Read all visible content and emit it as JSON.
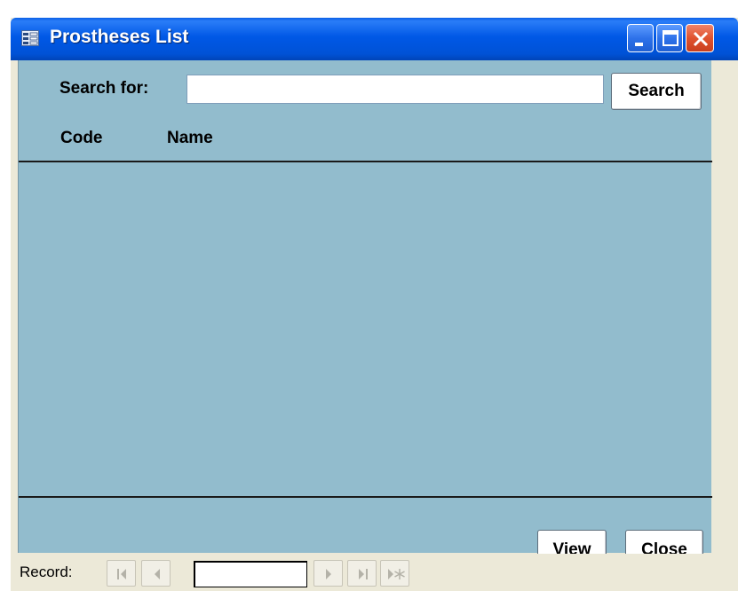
{
  "window": {
    "title": "Prostheses List"
  },
  "search": {
    "label": "Search for:",
    "value": "",
    "button_label": "Search"
  },
  "list": {
    "columns": [
      "Code",
      "Name"
    ],
    "rows": []
  },
  "actions": {
    "view_label": "View",
    "close_label": "Close"
  },
  "record_nav": {
    "label": "Record:",
    "current": ""
  },
  "colors": {
    "form_background": "#92bccd",
    "titlebar": "#0058e6",
    "close_button": "#e0532f"
  }
}
